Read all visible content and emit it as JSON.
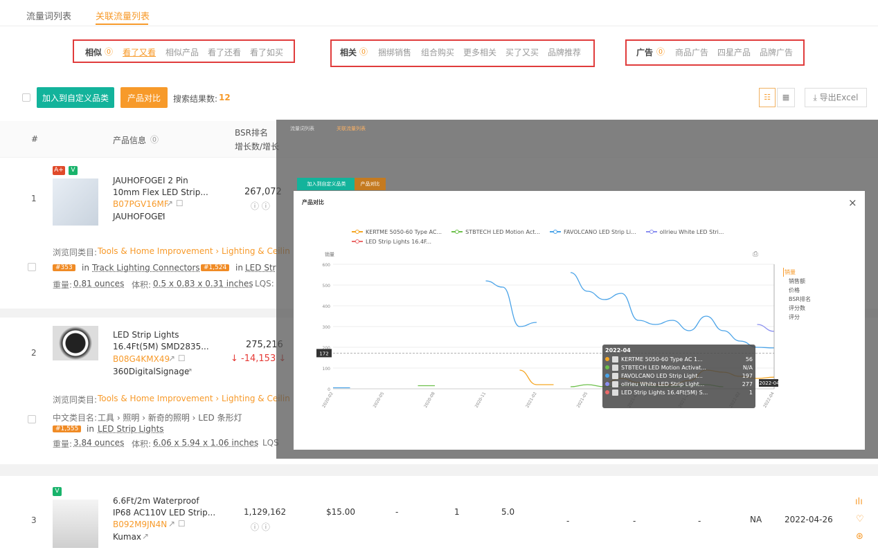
{
  "tabs": [
    {
      "label": "流量词列表"
    },
    {
      "label": "关联流量列表"
    }
  ],
  "filters": {
    "similar": {
      "title": "相似",
      "items": [
        "看了又看",
        "相似产品",
        "看了还看",
        "看了如买"
      ]
    },
    "related": {
      "title": "相关",
      "items": [
        "捆绑销售",
        "组合购买",
        "更多相关",
        "买了又买",
        "品牌推荐"
      ]
    },
    "ads": {
      "title": "广告",
      "items": [
        "商品广告",
        "四星产品",
        "品牌广告"
      ]
    }
  },
  "toolbar": {
    "add_custom": "加入到自定义品类",
    "compare": "产品对比",
    "result_label": "搜索结果数:",
    "result_count": "12",
    "export": "导出Excel"
  },
  "table_header": {
    "index": "#",
    "product_info": "产品信息",
    "bsr_line1": "BSR排名",
    "bsr_line2": "增长数/增长"
  },
  "products": [
    {
      "index": "1",
      "badges": [
        "A+",
        "V"
      ],
      "title_line1": "JAUHOFOGEI 2 Pin",
      "title_line2": "10mm Flex LED Strip...",
      "asin": "B07PGV16MF",
      "brand": "JAUHOFOGEI",
      "bsr": "267,072",
      "category_label": "浏览同类目:",
      "category_path": "Tools & Home Improvement › Lighting & Ceilin",
      "rank1": "#353",
      "rank1_in": "in",
      "rank1_cat": "Track Lighting Connectors",
      "rank2": "#1,524",
      "rank2_in": "in",
      "rank2_cat": "LED Str",
      "weight_label": "重量:",
      "weight": "0.81 ounces",
      "volume_label": "体积:",
      "volume": "0.5 x 0.83 x 0.31 inches",
      "lqs": "LQS:"
    },
    {
      "index": "2",
      "title_line1": "LED Strip Lights",
      "title_line2": "16.4Ft(5M) SMD2835...",
      "asin": "B08G4KMX49",
      "brand": "360DigitalSignage",
      "bsr": "275,216",
      "bsr_change": "-14,153",
      "category_label": "浏览同类目:",
      "category_path": "Tools & Home Improvement › Lighting & Ceilin",
      "cn_category_label": "中文类目名:",
      "cn_category": "工具 › 照明 › 新奇的照明 › LED 条形灯",
      "rank1": "#1,555",
      "rank1_in": "in",
      "rank1_cat": "LED Strip Lights",
      "weight_label": "重量:",
      "weight": "3.84 ounces",
      "volume_label": "体积:",
      "volume": "6.06 x 5.94 x 1.06 inches",
      "lqs": "LQS"
    },
    {
      "index": "3",
      "badges": [
        "V"
      ],
      "title_line1": "6.6Ft/2m Waterproof",
      "title_line2": "IP68 AC110V LED Strip...",
      "asin": "B092M9JN4N",
      "brand": "Kumax",
      "bsr": "1,129,162",
      "price": "$15.00",
      "col_a": "-",
      "col_b": "1",
      "rating": "5.0",
      "col_c": "-",
      "col_d": "-",
      "col_e": "-",
      "na": "NA",
      "date": "2022-04-26"
    }
  ],
  "modal": {
    "title": "产品对比",
    "close": "×",
    "yaxis_label": "销量",
    "side_menu": [
      "销量",
      "销售额",
      "价格",
      "BSR排名",
      "评分数",
      "评分"
    ],
    "crosshair_value": "172",
    "crosshair_date": "2022-04"
  },
  "chart_data": {
    "type": "line",
    "title": "",
    "ylabel": "销量",
    "ylim": [
      0,
      600
    ],
    "yticks": [
      "600",
      "500",
      "400",
      "300",
      "200",
      "100",
      "0"
    ],
    "xticks": [
      "2020-02",
      "2020-05",
      "2020-08",
      "2020-11",
      "2021-02",
      "2021-05",
      "2021-08",
      "2021-11",
      "2022-02",
      "2022-04"
    ],
    "x": [
      "2020-02",
      "2020-03",
      "2020-04",
      "2020-05",
      "2020-06",
      "2020-07",
      "2020-08",
      "2020-09",
      "2020-10",
      "2020-11",
      "2020-12",
      "2021-01",
      "2021-02",
      "2021-03",
      "2021-04",
      "2021-05",
      "2021-06",
      "2021-07",
      "2021-08",
      "2021-09",
      "2021-10",
      "2021-11",
      "2021-12",
      "2022-01",
      "2022-02",
      "2022-03",
      "2022-04"
    ],
    "series": [
      {
        "name": "KERTME 5050-60 Type AC...",
        "color": "#f5a623",
        "values": [
          null,
          null,
          null,
          null,
          null,
          null,
          null,
          null,
          null,
          null,
          null,
          90,
          20,
          20,
          null,
          null,
          30,
          50,
          30,
          20,
          20,
          40,
          90,
          80,
          60,
          50,
          56
        ]
      },
      {
        "name": "STBTECH LED Motion Act...",
        "color": "#6cc04a",
        "values": [
          null,
          null,
          null,
          null,
          null,
          15,
          15,
          null,
          null,
          null,
          null,
          null,
          null,
          null,
          10,
          20,
          10,
          15,
          20,
          10,
          10,
          15,
          20,
          10,
          null,
          null,
          null
        ]
      },
      {
        "name": "FAVOLCANO LED Strip Li...",
        "color": "#4aa3e8",
        "values": [
          5,
          5,
          null,
          null,
          null,
          null,
          null,
          null,
          null,
          520,
          490,
          300,
          320,
          null,
          560,
          470,
          430,
          460,
          330,
          310,
          330,
          280,
          350,
          280,
          230,
          200,
          197
        ]
      },
      {
        "name": "ollrieu White LED Stri...",
        "color": "#8a8ff0",
        "values": [
          null,
          null,
          null,
          null,
          null,
          null,
          null,
          null,
          null,
          null,
          null,
          null,
          null,
          null,
          null,
          null,
          null,
          null,
          null,
          null,
          null,
          null,
          null,
          null,
          null,
          310,
          277
        ]
      },
      {
        "name": "LED Strip Lights 16.4F...",
        "color": "#ea6a6a",
        "values": [
          null,
          null,
          null,
          null,
          null,
          null,
          null,
          null,
          null,
          null,
          null,
          null,
          null,
          null,
          null,
          null,
          null,
          null,
          null,
          null,
          null,
          null,
          null,
          null,
          null,
          null,
          1
        ]
      }
    ],
    "tooltip": {
      "date": "2022-04",
      "rows": [
        {
          "name": "KERTME 5050-60 Type AC 1...",
          "value": "56",
          "color": "#f5a623"
        },
        {
          "name": "STBTECH LED Motion Activat...",
          "value": "N/A",
          "color": "#6cc04a"
        },
        {
          "name": "FAVOLCANO LED Strip Light...",
          "value": "197",
          "color": "#4aa3e8"
        },
        {
          "name": "ollrieu White LED Strip Light...",
          "value": "277",
          "color": "#8a8ff0"
        },
        {
          "name": "LED Strip Lights 16.4Ft(5M) S...",
          "value": "1",
          "color": "#ea6a6a"
        }
      ]
    }
  }
}
